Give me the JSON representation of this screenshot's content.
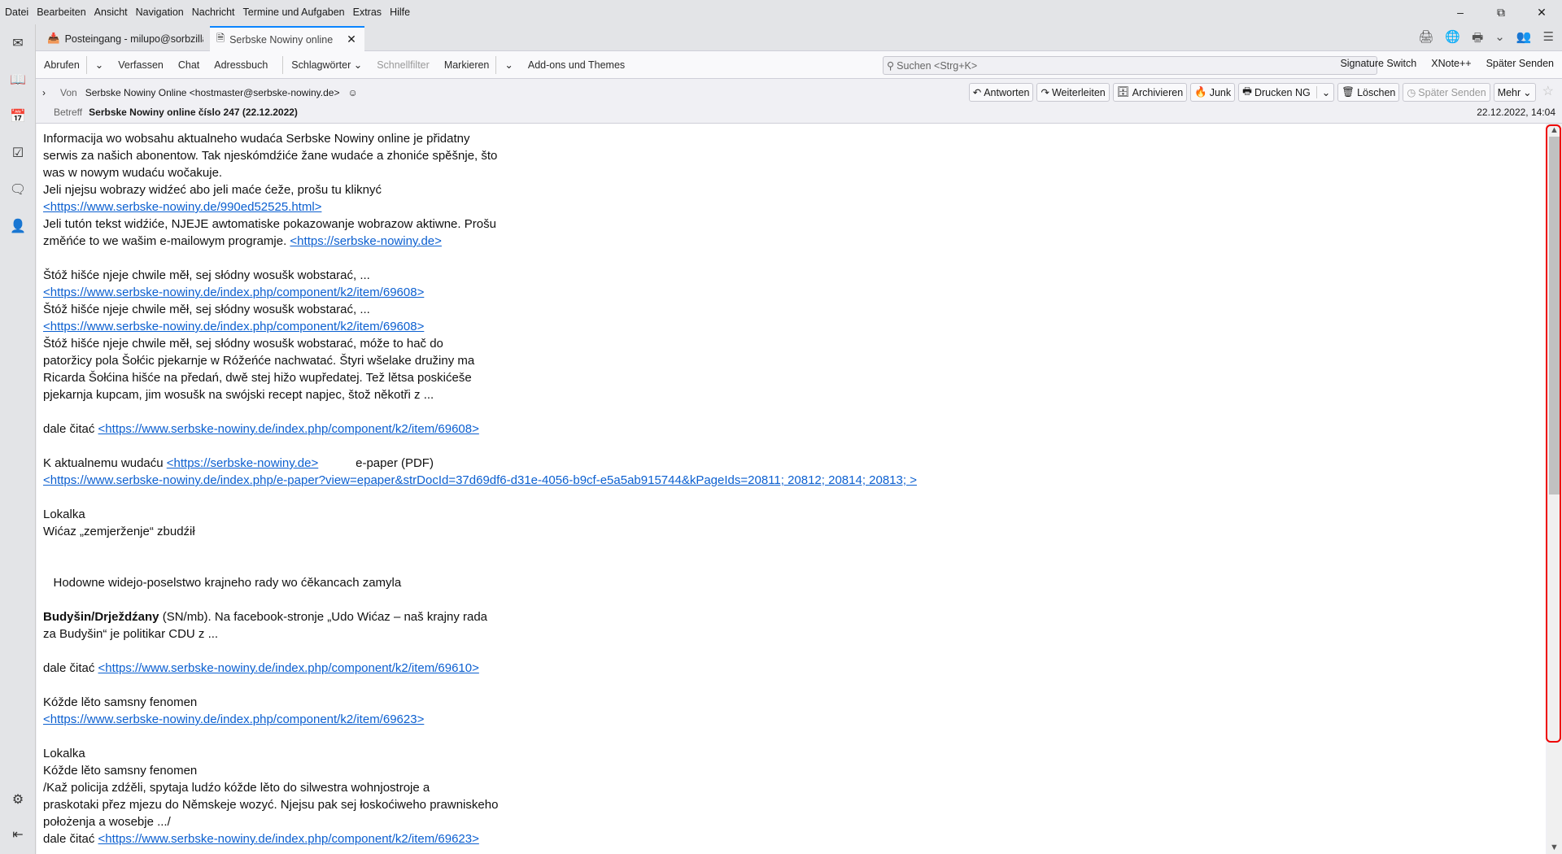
{
  "menu": [
    "Datei",
    "Bearbeiten",
    "Ansicht",
    "Navigation",
    "Nachricht",
    "Termine und Aufgaben",
    "Extras",
    "Hilfe"
  ],
  "tabs": [
    {
      "label": "Posteingang - milupo@sorbzilla"
    },
    {
      "label": "Serbske Nowiny online číslo"
    }
  ],
  "toolbar": {
    "abrufen": "Abrufen",
    "verfassen": "Verfassen",
    "chat": "Chat",
    "adressbuch": "Adressbuch",
    "schlagwoerter": "Schlagwörter",
    "schnellfilter": "Schnellfilter",
    "markieren": "Markieren",
    "addons": "Add-ons und Themes",
    "search_placeholder": "Suchen <Strg+K>",
    "signature": "Signature Switch",
    "xnote": "XNote++",
    "spaeter": "Später Senden"
  },
  "header": {
    "from_label": "Von",
    "from": "Serbske Nowiny Online <hostmaster@serbske-nowiny.de>",
    "subject_label": "Betreff",
    "subject": "Serbske Nowiny online číslo 247 (22.12.2022)",
    "date": "22.12.2022, 14:04",
    "buttons": [
      "Antworten",
      "Weiterleiten",
      "Archivieren",
      "Junk",
      "Drucken NG",
      "Löschen",
      "Später Senden",
      "Mehr"
    ]
  },
  "body": [
    [
      {
        "t": "Informacija wo wobsahu aktualneho wudaća Serbske Nowiny online je přidatny"
      }
    ],
    [
      {
        "t": "serwis za našich abonentow. Tak njeskómdźiće žane wudaće a zhoniće spěšnje, što"
      }
    ],
    [
      {
        "t": "was w nowym wudaću wočakuje."
      }
    ],
    [
      {
        "t": "Jeli njejsu wobrazy widźeć abo jeli maće ćeže, prošu tu kliknyć"
      }
    ],
    [
      {
        "l": "<https://www.serbske-nowiny.de/990ed52525.html>"
      }
    ],
    [
      {
        "t": "Jeli tutón tekst widźiće, NJEJE awtomatiske pokazowanje wobrazow aktiwne. Prošu"
      }
    ],
    [
      {
        "t": "změńće to we wašim e-mailowym programje. "
      },
      {
        "l": "<https://serbske-nowiny.de>"
      }
    ],
    [],
    [
      {
        "t": "Štóž hišće njeje chwile měł, sej słódny wosušk wobstarać, ..."
      }
    ],
    [
      {
        "l": "<https://www.serbske-nowiny.de/index.php/component/k2/item/69608>"
      }
    ],
    [
      {
        "t": "Štóž hišće njeje chwile měł, sej słódny wosušk wobstarać, ..."
      }
    ],
    [
      {
        "l": "<https://www.serbske-nowiny.de/index.php/component/k2/item/69608>"
      }
    ],
    [
      {
        "t": "Štóž hišće njeje chwile měł, sej słódny wosušk wobstarać, móže to hač do"
      }
    ],
    [
      {
        "t": "patoržicy pola Šołćic pjekarnje w Róžeńće nachwatać. Štyri wšelake družiny ma"
      }
    ],
    [
      {
        "t": "Ricarda Šołćina hišće na předań, dwě stej hižo wupředatej. Tež lětsa poskićeše"
      }
    ],
    [
      {
        "t": "pjekarnja kupcam, jim wosušk na swójski recept napjec, štož někotři z ..."
      }
    ],
    [],
    [
      {
        "t": "dale čitać "
      },
      {
        "l": "<https://www.serbske-nowiny.de/index.php/component/k2/item/69608>"
      }
    ],
    [],
    [
      {
        "t": "K aktualnemu wudaću "
      },
      {
        "l": "<https://serbske-nowiny.de>"
      },
      {
        "t": "           e-paper (PDF)"
      }
    ],
    [
      {
        "l": "<https://www.serbske-nowiny.de/index.php/e-paper?view=epaper&strDocId=37d69df6-d31e-4056-b9cf-e5a5ab915744&kPageIds=20811; 20812; 20814; 20813; >"
      }
    ],
    [],
    [
      {
        "t": "Lokalka"
      }
    ],
    [
      {
        "t": "Wićaz „zemjerženje“ zbudźił"
      }
    ],
    [],
    [],
    [
      {
        "t": "   Hodowne widejo-poselstwo krajneho rady wo ćěkancach zamyla"
      }
    ],
    [],
    [
      {
        "b": "Budyšin/Drježdźany"
      },
      {
        "t": " (SN/mb). Na facebook-stronje „Udo Wićaz – naš krajny rada"
      }
    ],
    [
      {
        "t": "za Budyšin“ je politikar CDU z ..."
      }
    ],
    [],
    [
      {
        "t": "dale čitać "
      },
      {
        "l": "<https://www.serbske-nowiny.de/index.php/component/k2/item/69610>"
      }
    ],
    [],
    [
      {
        "t": "Kóžde lěto samsny fenomen"
      }
    ],
    [
      {
        "l": "<https://www.serbske-nowiny.de/index.php/component/k2/item/69623>"
      }
    ],
    [],
    [
      {
        "t": "Lokalka"
      }
    ],
    [
      {
        "t": "Kóžde lěto samsny fenomen"
      }
    ],
    [
      {
        "t": "/Kaž policija zdźěli, spytaja ludźo kóžde lěto do silwestra wohnjostroje a"
      }
    ],
    [
      {
        "t": "praskotaki přez mjezu do Němskeje wozyć. Njejsu pak sej łoskoćiweho prawniskeho"
      }
    ],
    [
      {
        "t": "położenja a wosebje .../"
      }
    ],
    [
      {
        "t": "dale čitać "
      },
      {
        "l": "<https://www.serbske-nowiny.de/index.php/component/k2/item/69623>"
      }
    ]
  ],
  "colors": {
    "link": "#0b5fd0",
    "tab_accent": "#0a84ff",
    "highlight": "#e00000"
  },
  "scrollbar": {
    "position_fraction": 0
  }
}
